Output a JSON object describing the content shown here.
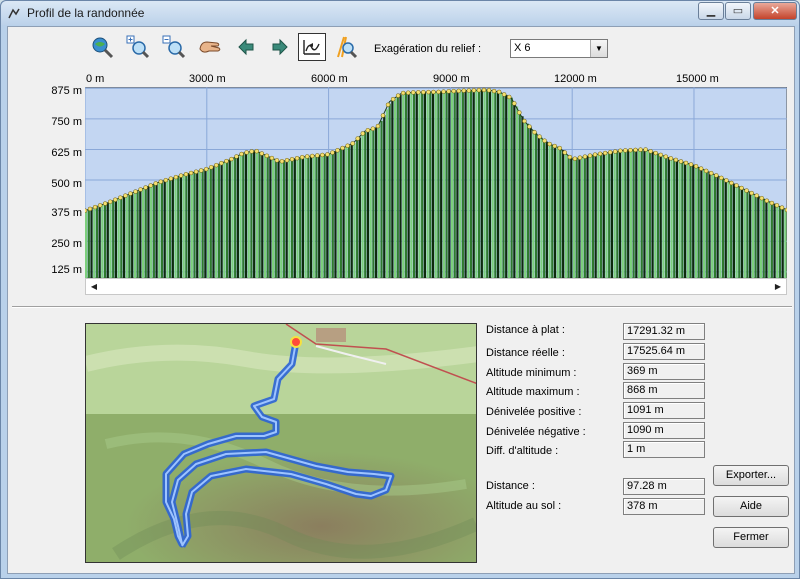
{
  "window": {
    "title": "Profil de la randonnée"
  },
  "toolbar": {
    "icons": [
      "zoom-globe-icon",
      "zoom-in-icon",
      "zoom-out-icon",
      "hand-pan-icon",
      "arrow-left-icon",
      "arrow-right-icon",
      "profile-graph-icon",
      "route-zoom-icon"
    ],
    "relief_label": "Exagération du relief :",
    "relief_value": "X 6"
  },
  "chart_data": {
    "type": "area",
    "x_ticks": [
      "0 m",
      "3000 m",
      "6000 m",
      "9000 m",
      "12000 m",
      "15000 m"
    ],
    "y_ticks": [
      "875 m",
      "750 m",
      "625 m",
      "500 m",
      "375 m",
      "250 m",
      "125 m"
    ],
    "xlim": [
      0,
      17291
    ],
    "ylim": [
      100,
      880
    ],
    "x": [
      0,
      600,
      1200,
      1800,
      2400,
      3000,
      3300,
      3600,
      3900,
      4200,
      4800,
      5400,
      6000,
      6600,
      6900,
      7200,
      7500,
      7800,
      8100,
      8700,
      9300,
      9900,
      10200,
      10500,
      10800,
      11100,
      11400,
      11700,
      12000,
      12600,
      13200,
      13800,
      14400,
      15000,
      15600,
      16200,
      16800,
      17291
    ],
    "y": [
      375,
      410,
      450,
      490,
      520,
      545,
      565,
      585,
      610,
      620,
      575,
      595,
      605,
      650,
      700,
      715,
      820,
      855,
      858,
      860,
      865,
      868,
      860,
      835,
      745,
      690,
      650,
      630,
      585,
      605,
      620,
      625,
      590,
      560,
      515,
      465,
      415,
      378
    ],
    "grid": true,
    "colors": {
      "background": "#c3d6f2",
      "bars": "#2f7a2f",
      "bars_light": "#7cd07c",
      "points": "#f5e070"
    }
  },
  "stats": [
    {
      "label": "Distance à plat :",
      "value": "17291.32 m"
    },
    {
      "label": "Distance réelle :",
      "value": "17525.64 m"
    },
    {
      "label": "Altitude minimum :",
      "value": "369 m"
    },
    {
      "label": "Altitude maximum :",
      "value": "868 m"
    },
    {
      "label": "Dénivelée positive :",
      "value": "1091 m"
    },
    {
      "label": "Dénivelée négative :",
      "value": "1090 m"
    },
    {
      "label": "Diff. d'altitude :",
      "value": "1 m"
    }
  ],
  "cursor": [
    {
      "label": "Distance :",
      "value": "97.28 m"
    },
    {
      "label": "Altitude au sol :",
      "value": "378 m"
    }
  ],
  "buttons": {
    "export": "Exporter...",
    "help": "Aide",
    "close": "Fermer"
  }
}
